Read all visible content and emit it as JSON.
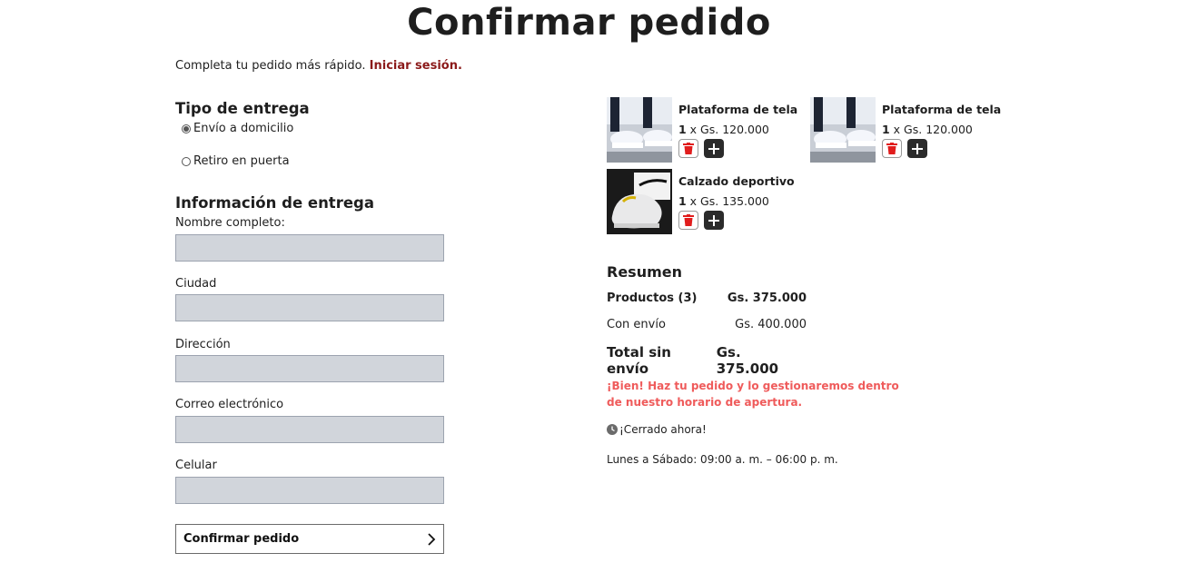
{
  "page": {
    "title": "Confirmar pedido"
  },
  "login": {
    "prompt": "Completa tu pedido más rápido.",
    "link": "Iniciar sesión."
  },
  "delivery_type": {
    "heading": "Tipo de entrega",
    "options": [
      {
        "label": "Envío a domicilio",
        "selected": true
      },
      {
        "label": "Retiro en puerta",
        "selected": false
      }
    ]
  },
  "delivery_info": {
    "heading": "Información de entrega",
    "fields": [
      {
        "label": "Nombre completo:",
        "value": ""
      },
      {
        "label": "Ciudad",
        "value": ""
      },
      {
        "label": "Dirección",
        "value": ""
      },
      {
        "label": "Correo electrónico",
        "value": ""
      },
      {
        "label": "Celular",
        "value": ""
      }
    ]
  },
  "confirm_button": {
    "label": "Confirmar pedido",
    "icon": "chevron-right-icon"
  },
  "cart": {
    "items": [
      {
        "name": "Plataforma de tela",
        "qty": "1",
        "price": " x Gs. 120.000",
        "image": "white-platform-sneaker"
      },
      {
        "name": "Plataforma de tela",
        "qty": "1",
        "price": " x Gs. 120.000",
        "image": "white-platform-sneaker"
      },
      {
        "name": "Calzado deportivo",
        "qty": "1",
        "price": " x Gs. 135.000",
        "image": "white-sport-shoe"
      }
    ],
    "actions": {
      "delete_icon": "trash-icon",
      "add_icon": "plus-icon",
      "delete_color": "#e11d1d",
      "add_color": "#2b2b2b"
    }
  },
  "summary": {
    "heading": "Resumen",
    "rows": [
      {
        "label": "Productos (3)",
        "value": "Gs. 375.000"
      },
      {
        "label": "Con envío",
        "value": "Gs. 400.000"
      },
      {
        "label": "Total sin envío",
        "value": "Gs. 375.000"
      }
    ],
    "notice": "¡Bien! Haz tu pedido y lo gestionaremos dentro de nuestro horario de apertura.",
    "status": "¡Cerrado ahora!",
    "status_icon": "clock-icon",
    "hours": "Lunes a Sábado: 09:00 a. m. – 06:00 p. m."
  },
  "colors": {
    "accent_link": "#8b1a1a",
    "notice": "#ef5b5b",
    "input_bg": "#d1d5db"
  }
}
